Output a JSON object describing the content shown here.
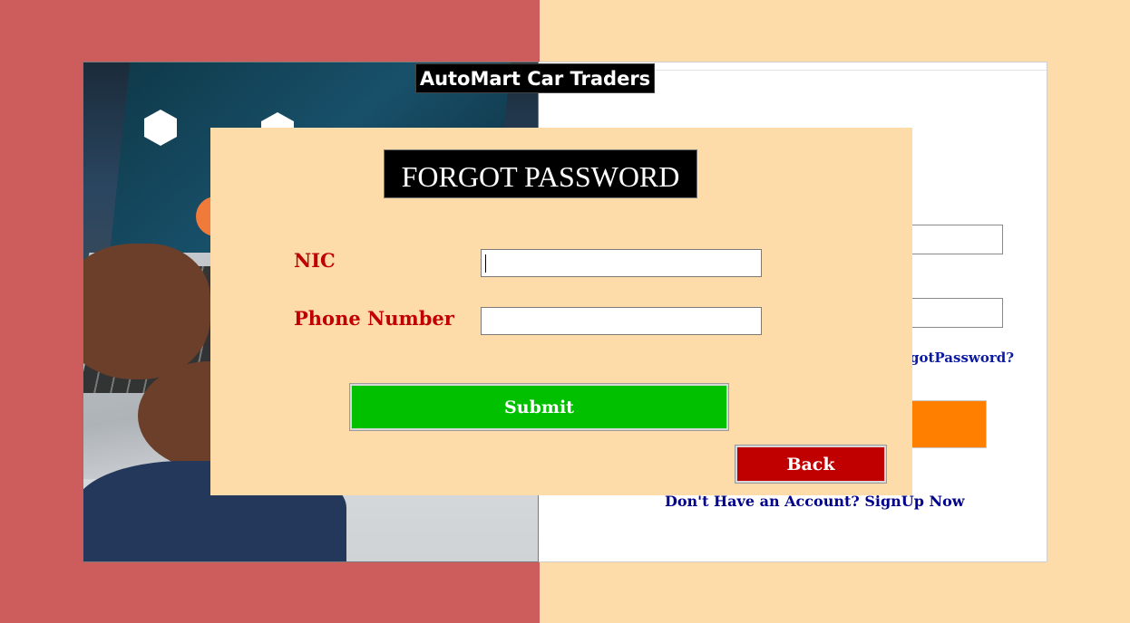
{
  "app": {
    "title": "AutoMart Car Traders"
  },
  "background": {
    "left_color": "#cd5c5c",
    "right_color": "#fddcaa"
  },
  "login": {
    "forgot_link_text": "gotPassword?",
    "signup_text": "Don't Have an Account? SignUp Now",
    "login_button_color": "#ff8000"
  },
  "dialog": {
    "title": "FORGOT PASSWORD",
    "nic_label": "NIC",
    "nic_value": "",
    "phone_label": "Phone Number",
    "phone_value": "",
    "submit_label": "Submit",
    "back_label": "Back",
    "colors": {
      "submit": "#00c000",
      "back": "#c00000",
      "label": "#c00000",
      "panel": "#fddcaa"
    }
  },
  "photo": {
    "subject": "hands-on-laptop-with-chart-hologram"
  }
}
